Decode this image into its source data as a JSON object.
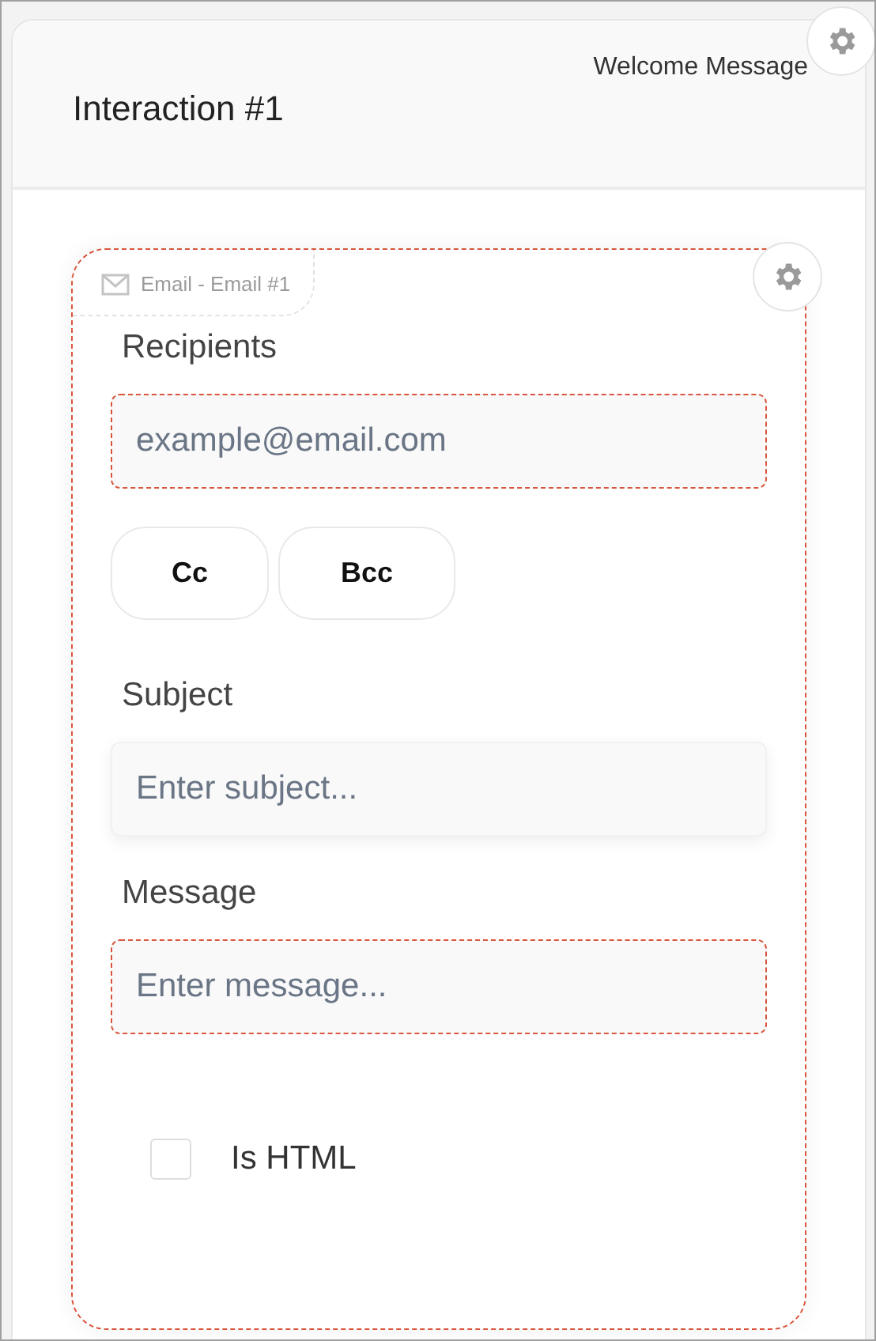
{
  "header": {
    "title": "Interaction #1",
    "subtitle": "Welcome Message"
  },
  "email_block": {
    "tag": "Email - Email #1",
    "fields": [
      {
        "label": "Recipients",
        "placeholder": "example@email.com",
        "invalid": true
      },
      {
        "kind": "buttons",
        "buttons": [
          "Cc",
          "Bcc"
        ]
      },
      {
        "label": "Subject",
        "placeholder": "Enter subject...",
        "invalid": false
      },
      {
        "label": "Message",
        "placeholder": "Enter message...",
        "invalid": true
      }
    ],
    "checkbox": {
      "label": "Is HTML",
      "checked": false
    }
  }
}
